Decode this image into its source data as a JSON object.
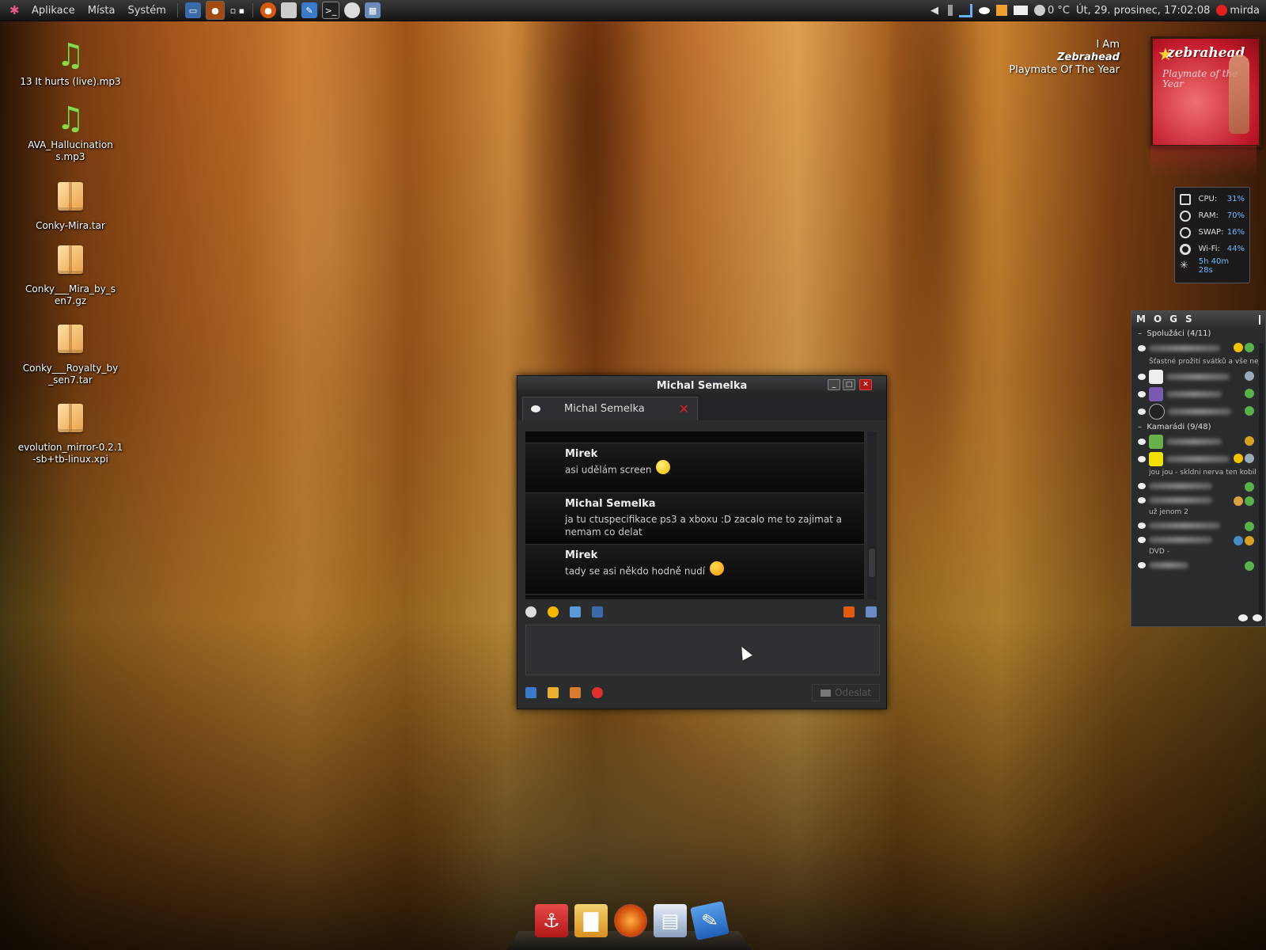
{
  "top_panel": {
    "menus": [
      "Aplikace",
      "Místa",
      "Systém"
    ],
    "weather": "0 °C",
    "datetime": "Út, 29. prosinec, 17:02:08",
    "user": "mirda"
  },
  "desktop_icons": [
    {
      "label": "13 It hurts (live).mp3",
      "type": "audio"
    },
    {
      "label": "AVA_Hallucinations.mp3",
      "type": "audio"
    },
    {
      "label": "Conky-Mira.tar",
      "type": "archive"
    },
    {
      "label": "Conky___Mira_by_sen7.gz",
      "type": "archive"
    },
    {
      "label": "Conky___Royalty_by_sen7.tar",
      "type": "archive"
    },
    {
      "label": "evolution_mirror-0.2.1-sb+tb-linux.xpi",
      "type": "archive"
    }
  ],
  "now_playing": {
    "title": "I Am",
    "artist": "Zebrahead",
    "album": "Playmate Of The Year",
    "cover_band": "zebrahead",
    "cover_sub": "Playmate of the Year"
  },
  "conky": {
    "rows": [
      {
        "label": "CPU:",
        "value": "31%"
      },
      {
        "label": "RAM:",
        "value": "70%"
      },
      {
        "label": "SWAP:",
        "value": "16%"
      },
      {
        "label": "Wi-Fi:",
        "value": "44%"
      }
    ],
    "uptime": "5h 40m 28s"
  },
  "contact_list": {
    "header": "MOGS",
    "groups": [
      {
        "name": "Spolužáci (4/11)"
      },
      {
        "name": "Kamarádi (9/48)"
      }
    ],
    "status_messages": [
      "Šťastné prožití svátků a vše nej",
      "jou jou - skldni nerva ten kobil",
      "už jenom 2",
      "DVD -"
    ]
  },
  "chat": {
    "window_title": "Michal Semelka",
    "tab_label": "Michal Semelka",
    "messages": [
      {
        "nick": "Mirek",
        "text": "asi udělám screen"
      },
      {
        "nick": "Michal Semelka",
        "text": "ja tu ctuspecifikace ps3 a xboxu :D zacalo me to zajimat a nemam co delat"
      },
      {
        "nick": "Mirek",
        "text": "tady se asi někdo hodně nudí"
      }
    ],
    "send_label": "Odeslat"
  }
}
